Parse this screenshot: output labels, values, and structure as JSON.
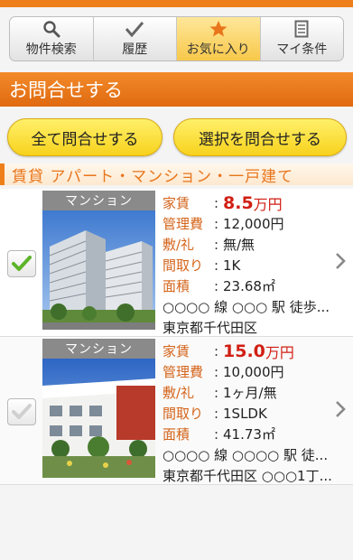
{
  "tabs": [
    {
      "label": "物件検索",
      "icon": "search-icon"
    },
    {
      "label": "履歴",
      "icon": "checkmark-icon"
    },
    {
      "label": "お気に入り",
      "icon": "star-icon"
    },
    {
      "label": "マイ条件",
      "icon": "document-icon"
    }
  ],
  "header": {
    "title": "お問合せする"
  },
  "buttons": {
    "all": "全て問合せする",
    "selected": "選択を問合せする"
  },
  "category": {
    "label": "賃貸 アパート・マンション・一戸建て"
  },
  "labels": {
    "rent": "家賃",
    "fee": "管理費",
    "deposit": "敷/礼",
    "layout": "間取り",
    "area": "面積",
    "colon": ":"
  },
  "properties": [
    {
      "type": "マンション",
      "checked": true,
      "rent_value": "8.5",
      "rent_unit": "万円",
      "fee": "12,000円",
      "deposit": "無/無",
      "layout": "1K",
      "area": "23.68㎡",
      "station": "○○○○ 線 ○○○ 駅 徒歩...",
      "address": "東京都千代田区"
    },
    {
      "type": "マンション",
      "checked": false,
      "rent_value": "15.0",
      "rent_unit": "万円",
      "fee": "10,000円",
      "deposit": "1ヶ月/無",
      "layout": "1SLDK",
      "area": "41.73㎡",
      "station": "○○○○ 線 ○○○○ 駅 徒...",
      "address": "東京都千代田区 ○○○1丁..."
    }
  ],
  "colors": {
    "accent": "#ef7f1a",
    "price": "#d11f14",
    "label": "#d4641a",
    "button": "#f7d21c"
  }
}
